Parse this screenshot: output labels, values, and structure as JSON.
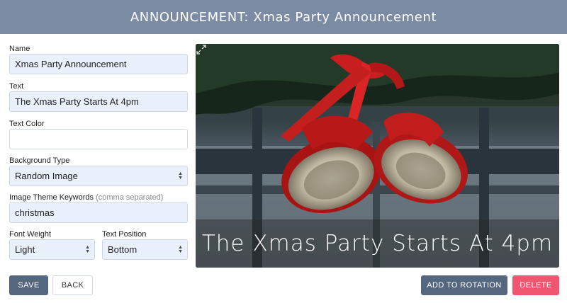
{
  "header": {
    "title": "ANNOUNCEMENT: Xmas Party Announcement"
  },
  "form": {
    "name": {
      "label": "Name",
      "value": "Xmas Party Announcement"
    },
    "text": {
      "label": "Text",
      "value": "The Xmas Party Starts At 4pm"
    },
    "text_color": {
      "label": "Text Color",
      "value": ""
    },
    "background_type": {
      "label": "Background Type",
      "value": "Random Image"
    },
    "image_keywords": {
      "label": "Image Theme Keywords",
      "hint": "(comma separated)",
      "value": "christmas"
    },
    "font_weight": {
      "label": "Font Weight",
      "value": "Light"
    },
    "text_position": {
      "label": "Text Position",
      "value": "Bottom"
    }
  },
  "preview": {
    "caption": "The Xmas Party Starts At 4pm",
    "expand_icon": "expand-icon",
    "image_subject": "red-christmas-bells"
  },
  "buttons": {
    "save": "SAVE",
    "back": "BACK",
    "add_to_rotation": "ADD TO ROTATION",
    "delete": "DELETE"
  },
  "colors": {
    "header_bg": "#7a8ba3",
    "primary": "#55667f",
    "danger": "#f0566f",
    "filled_field_bg": "#eaf1fd"
  }
}
